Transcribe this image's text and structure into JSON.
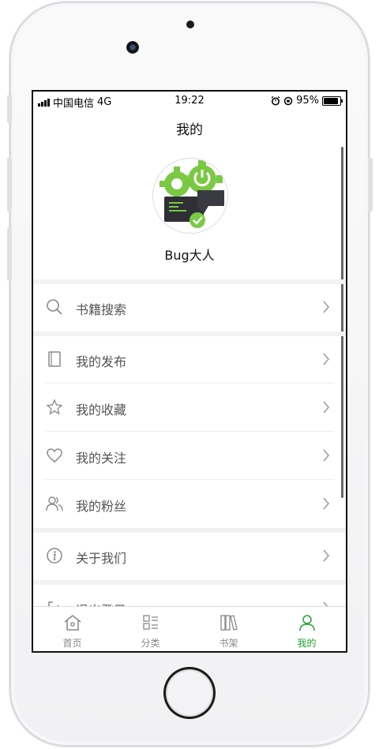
{
  "status_bar": {
    "carrier": "中国电信",
    "network": "4G",
    "time": "19:22",
    "battery": "95%"
  },
  "nav": {
    "title": "我的"
  },
  "profile": {
    "username": "Bug大人",
    "avatar_icon": "gear-laptop-avatar"
  },
  "menu": {
    "search": {
      "label": "书籍搜索",
      "icon": "search-icon"
    },
    "items": [
      {
        "label": "我的发布",
        "icon": "book-icon"
      },
      {
        "label": "我的收藏",
        "icon": "star-icon"
      },
      {
        "label": "我的关注",
        "icon": "heart-icon"
      },
      {
        "label": "我的粉丝",
        "icon": "users-icon"
      }
    ],
    "about": {
      "label": "关于我们",
      "icon": "info-icon"
    },
    "logout": {
      "label": "退出登录",
      "icon": "logout-icon"
    }
  },
  "tabbar": {
    "tabs": [
      {
        "label": "首页",
        "icon": "home-icon"
      },
      {
        "label": "分类",
        "icon": "category-icon"
      },
      {
        "label": "书架",
        "icon": "bookshelf-icon"
      },
      {
        "label": "我的",
        "icon": "user-icon"
      }
    ],
    "active_index": 3
  },
  "colors": {
    "accent": "#23a532",
    "avatar_green": "#7ac943",
    "background_gap": "#f2f2f2"
  }
}
